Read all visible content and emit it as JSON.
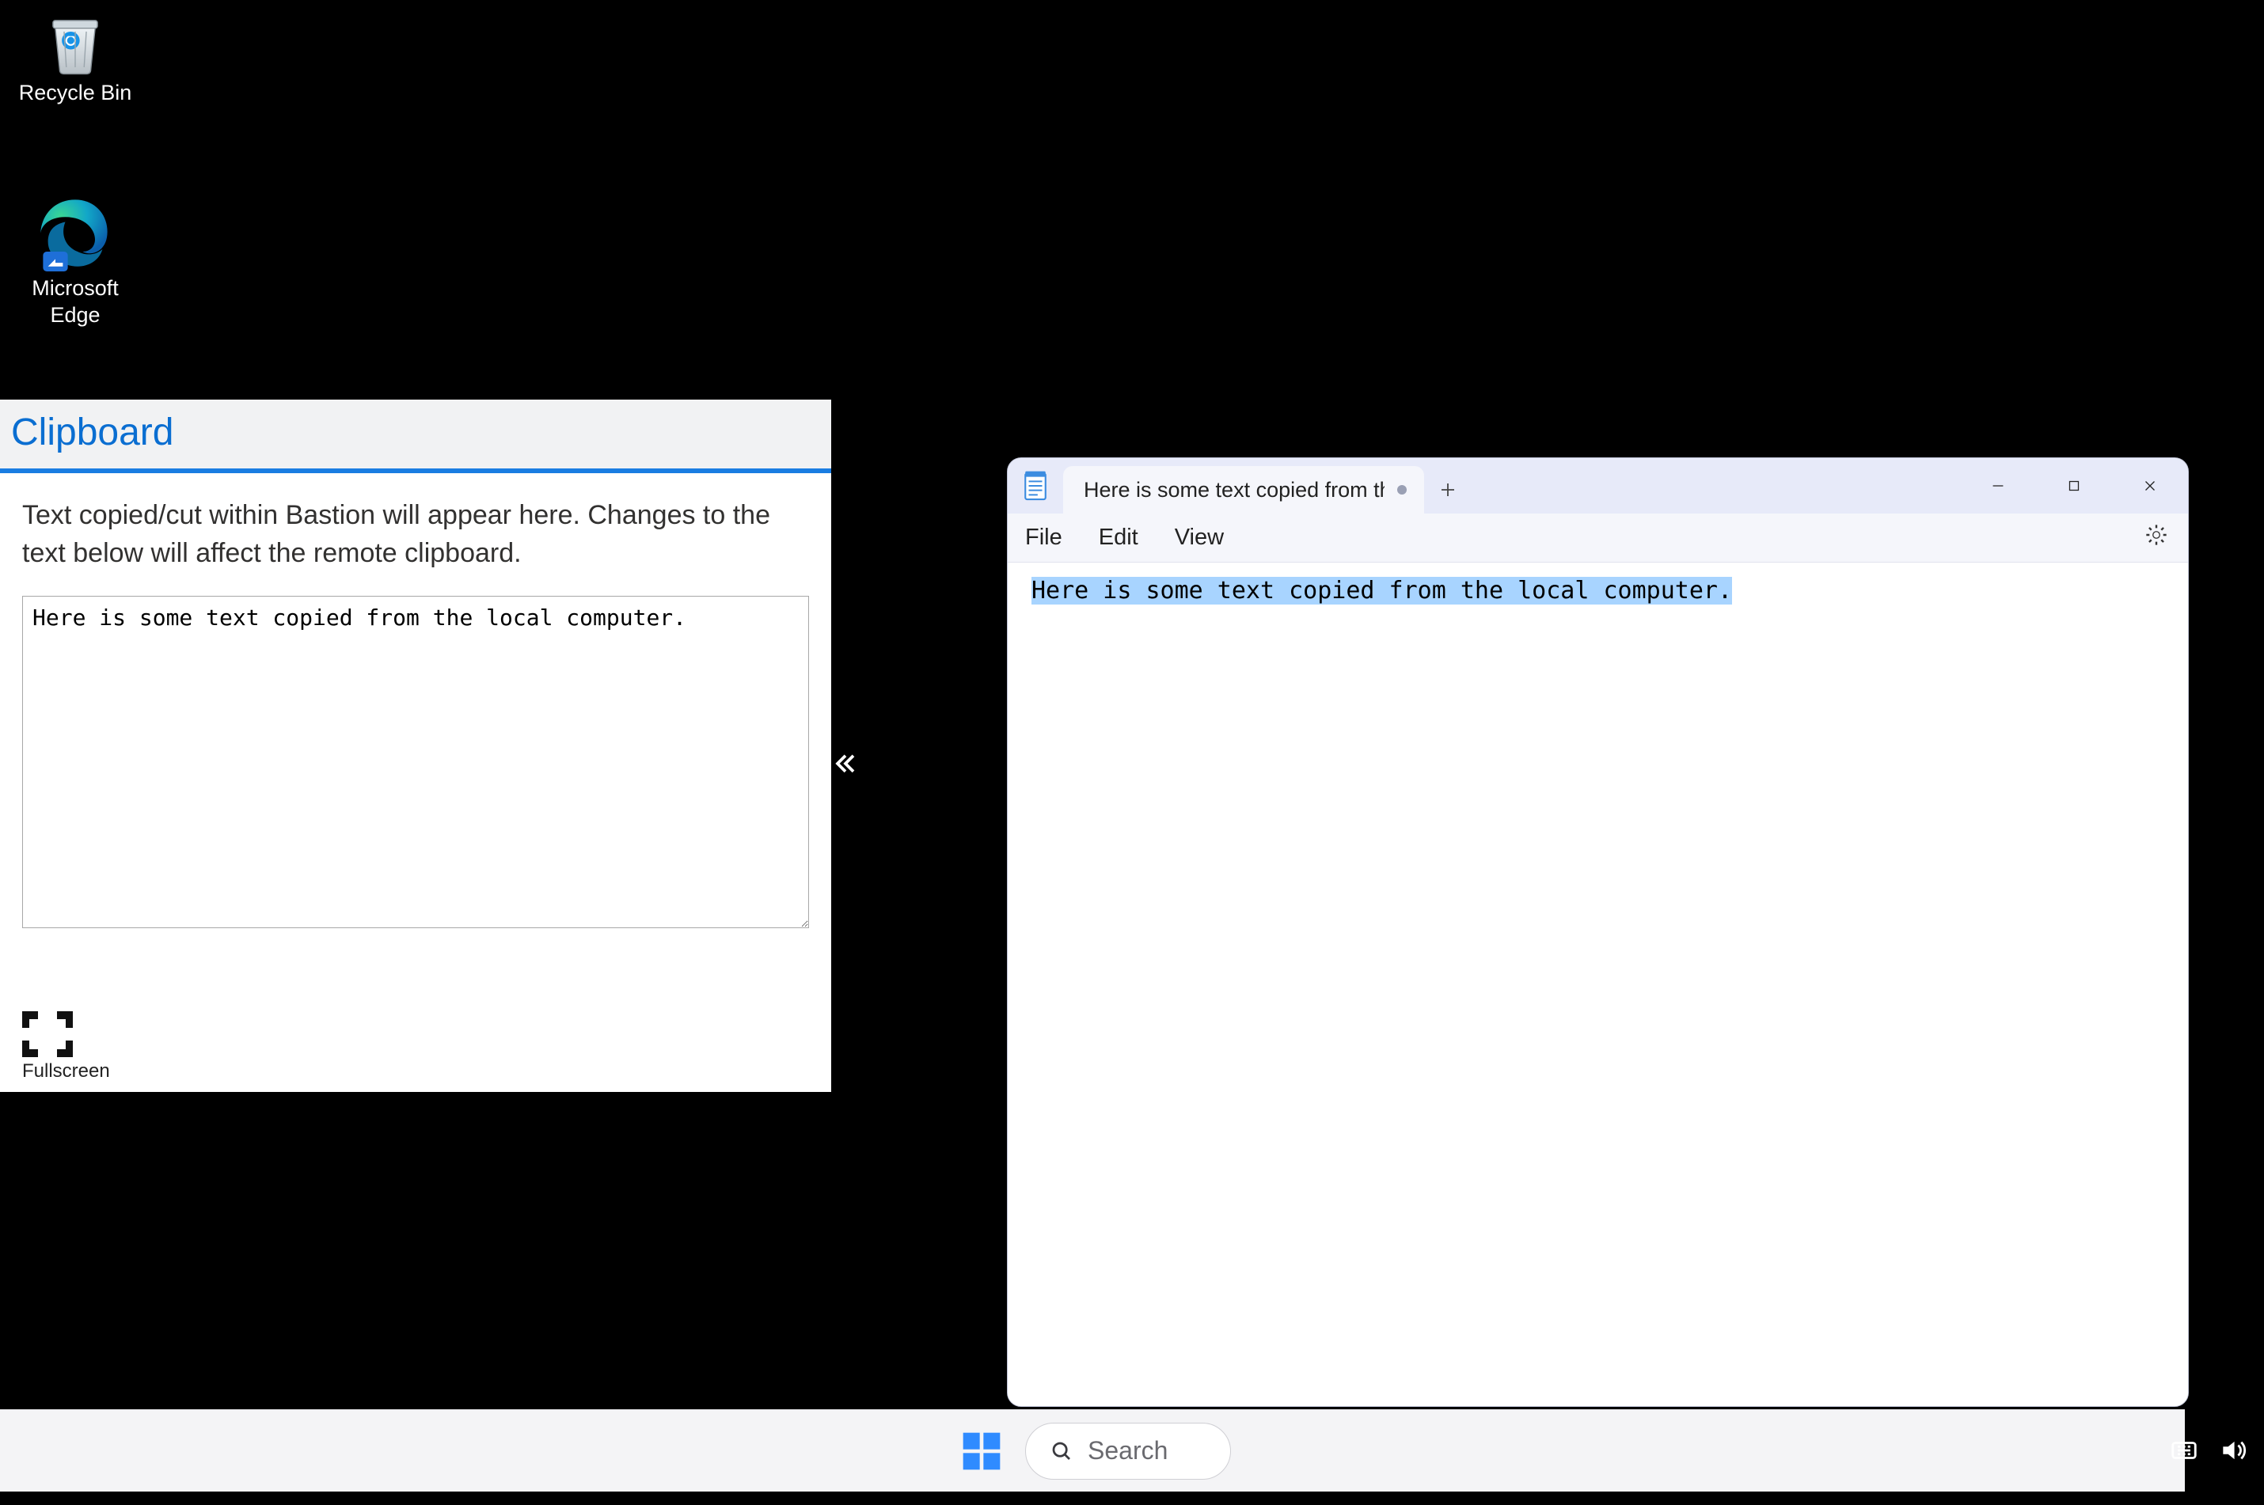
{
  "desktop": {
    "recycle_bin_label": "Recycle Bin",
    "edge_label": "Microsoft\nEdge"
  },
  "clipboard_panel": {
    "title": "Clipboard",
    "description": "Text copied/cut within Bastion will appear here. Changes to the text below will affect the remote clipboard.",
    "textarea_value": "Here is some text copied from the local computer.",
    "fullscreen_label": "Fullscreen"
  },
  "notepad": {
    "tab_title": "Here is some text copied from the l",
    "menus": {
      "file": "File",
      "edit": "Edit",
      "view": "View"
    },
    "content_selected": "Here is some text copied from the local computer."
  },
  "taskbar": {
    "search_placeholder": "Search"
  }
}
